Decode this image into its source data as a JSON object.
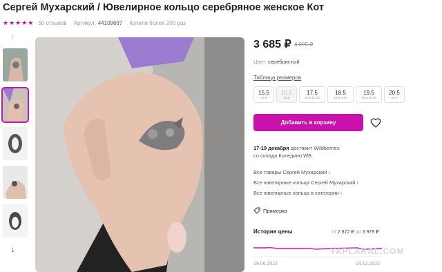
{
  "product": {
    "title": "Сергей Мухарский / Ювелирное кольцо серебряное женское Кот",
    "stars": "★★★★★",
    "reviews": "50 отзывов",
    "article_label": "Артикул:",
    "article": "44109697",
    "bought": "Купили более 200 раз"
  },
  "price": {
    "current": "3 685 ₽",
    "old": "4 095 ₽"
  },
  "color": {
    "label": "Цвет:",
    "value": "серебристый"
  },
  "size_table_link": "Таблица размеров",
  "sizes": [
    {
      "n": "15.5",
      "s": "15.5",
      "disabled": false
    },
    {
      "n": "16.5",
      "s": "16.5",
      "disabled": true
    },
    {
      "n": "17.5",
      "s": "17.5-10.10",
      "disabled": false
    },
    {
      "n": "18.5",
      "s": "18.5-0.40",
      "disabled": false
    },
    {
      "n": "19.5",
      "s": "19.5-19.85",
      "disabled": false
    },
    {
      "n": "20.5",
      "s": "20.5",
      "disabled": false
    }
  ],
  "buy_button": "Добавить в корзину",
  "delivery": {
    "date": "17-19 декабря",
    "text": " доставит Wildberries",
    "warehouse": "со склада Коледино WB"
  },
  "links": [
    "Все товары Сергей Мухарский ›",
    "Все ювелирные кольца Сергей Мухарский ›",
    "Все ювелирные кольца в категории ›"
  ],
  "try_on": "Примерка",
  "history": {
    "title": "История цены",
    "from_label": "от ",
    "from": "2 872 ₽",
    "to_label": " до ",
    "to": "3 979 ₽",
    "date_start": "19.06.2022",
    "date_end": "14.12.2022"
  },
  "watermark": "YAPLAKAL.COM",
  "colors": {
    "accent": "#cb11ab"
  },
  "icons": {
    "up": "chevron-up-icon",
    "down": "chevron-down-icon",
    "favorite": "heart-icon",
    "try_on": "tag-icon"
  }
}
